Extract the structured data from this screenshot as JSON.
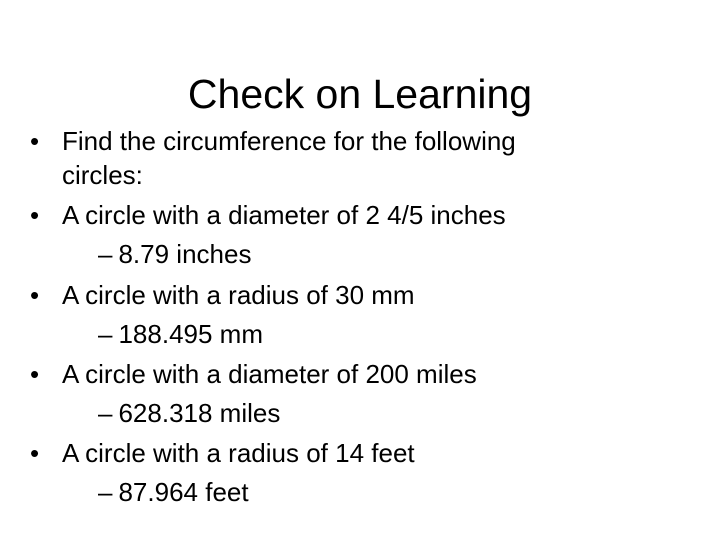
{
  "slide": {
    "title": "Check on Learning",
    "bullet_glyph": "•",
    "dash_glyph": "–",
    "items": [
      {
        "text_line1": "Find the circumference for the following",
        "text_line2": "circles:"
      },
      {
        "text": "A circle with a diameter of 2 4/5 inches",
        "answer": "8.79 inches"
      },
      {
        "text": "A circle with a radius of 30 mm",
        "answer": "188.495 mm"
      },
      {
        "text": "A circle with a diameter of 200 miles",
        "answer": "628.318 miles"
      },
      {
        "text": "A circle with a radius of 14 feet",
        "answer": "87.964 feet"
      }
    ]
  }
}
